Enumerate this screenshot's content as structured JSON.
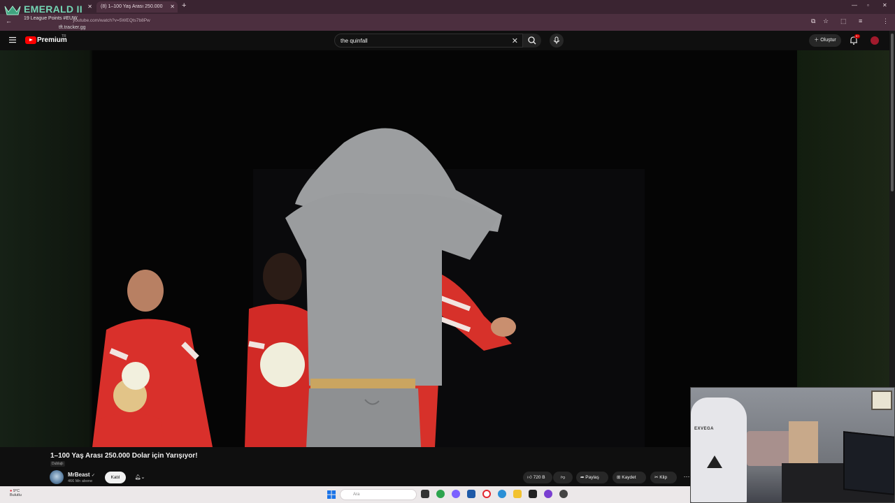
{
  "browser": {
    "tabs": [
      {
        "label": "EMERALD II"
      },
      {
        "label": "(8) 1–100 Yaş Arası 250.000"
      }
    ],
    "address": "youtube.com/watch?v=5WEQts7b8Pw"
  },
  "overlay": {
    "title": "EMERALD II",
    "subtitle": "19 League Points #EUW",
    "site": "tft.tracker.gg"
  },
  "masthead": {
    "brand": "Premium",
    "region": "TR",
    "search_value": "the quinfall",
    "create_label": "Oluştur",
    "notification_count": "9+"
  },
  "video": {
    "title": "1–100 Yaş Arası 250.000 Dolar için Yarışıyor!",
    "dub_badge": "Dublajlı",
    "channel": "MrBeast",
    "verified": "✓",
    "subscribers": "466 Mn abone",
    "join_label": "Katıl",
    "like_count": "720 B",
    "share_label": "Paylaş",
    "save_label": "Kaydet",
    "clip_label": "Klip"
  },
  "taskbar": {
    "weather_temp": "9°C",
    "weather_desc": "Bulutlu",
    "search_placeholder": "Ara"
  },
  "webcam": {
    "chair_brand": "EXVEGA"
  },
  "colors": {
    "accent": "#ff0000",
    "emerald": "#74d6b4",
    "browser_bg": "#3a2431"
  }
}
